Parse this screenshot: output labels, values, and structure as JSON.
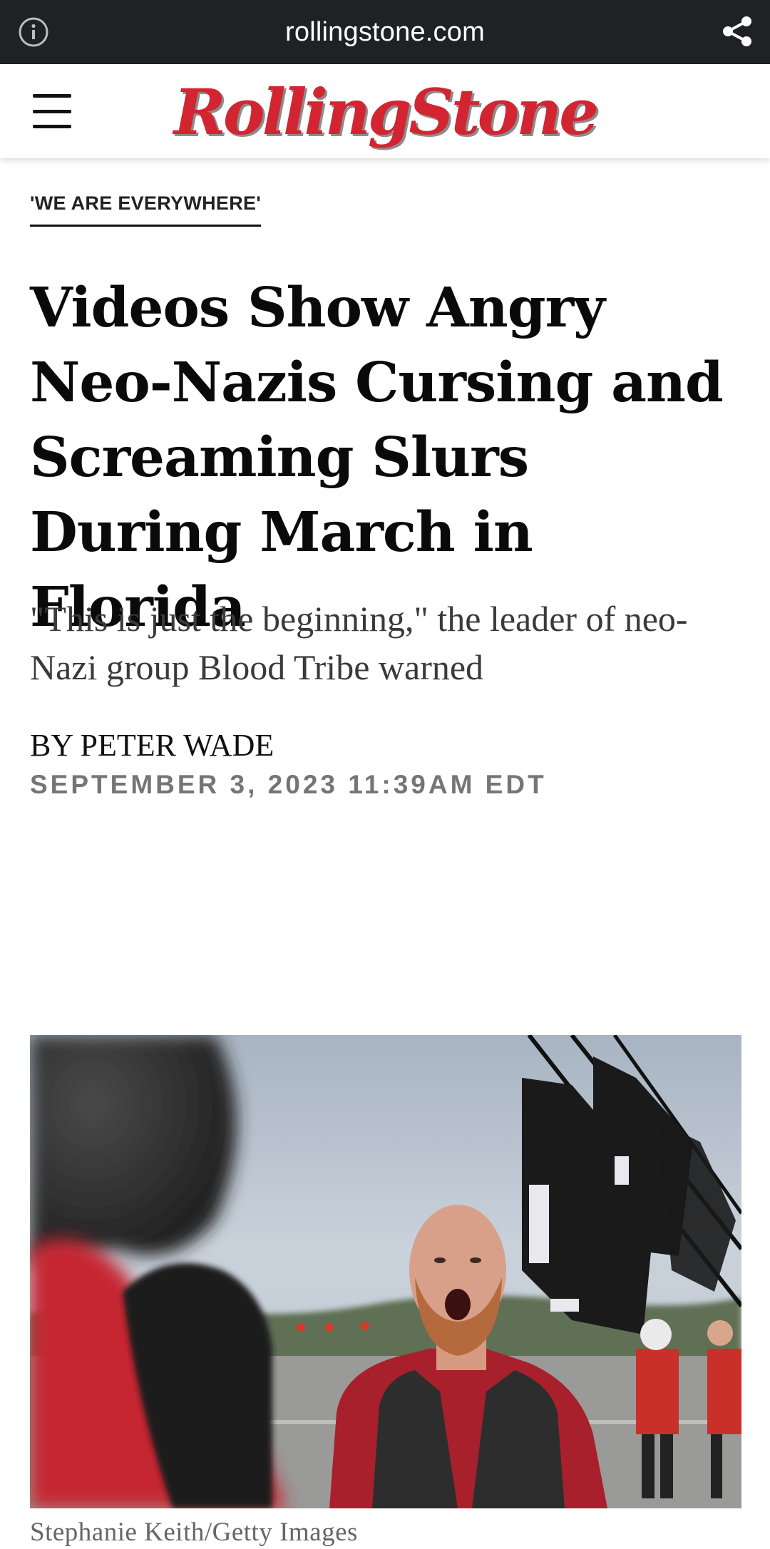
{
  "browser": {
    "url": "rollingstone.com",
    "info_icon": "info-icon",
    "share_icon": "share-icon"
  },
  "header": {
    "menu_icon": "hamburger-menu-icon",
    "logo_text": "RollingStone",
    "logo_color": "#d32531"
  },
  "article": {
    "kicker": "'WE ARE EVERYWHERE'",
    "headline": "Videos Show Angry Neo-Nazis Cursing and Screaming Slurs During March in Florida",
    "dek": "\"This is just the beginning,\" the leader of neo-Nazi group Blood Tribe warned",
    "byline_prefix": "BY ",
    "author": "PETER WADE",
    "date": "SEPTEMBER 3, 2023 11:39AM EDT",
    "photo_credit": "Stephanie Keith/Getty Images"
  }
}
